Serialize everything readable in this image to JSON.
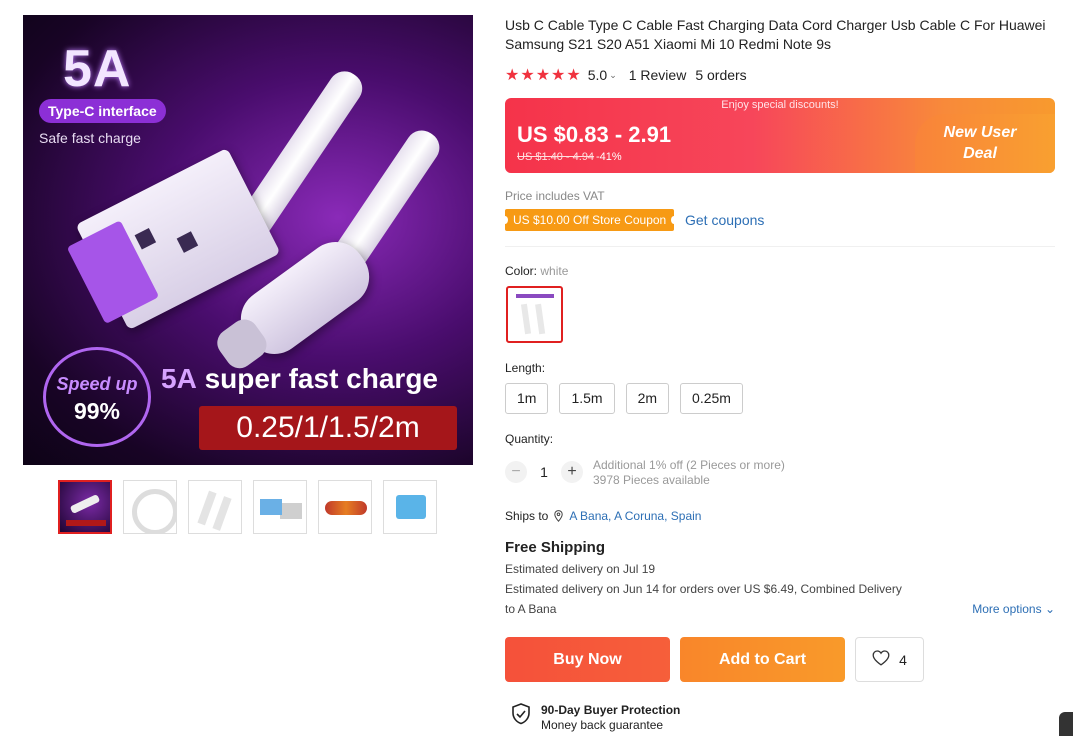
{
  "gallery": {
    "main_image": {
      "badge_5a": "5A",
      "badge_type_c": "Type-C interface",
      "safe_text": "Safe fast charge",
      "speed_label": "Speed up",
      "speed_value": "99%",
      "headline_prefix": "5A",
      "headline_rest": " super fast charge",
      "lengths_banner": "0.25/1/1.5/2m"
    },
    "thumbnail_count": 6
  },
  "product": {
    "title": "Usb C Cable Type C Cable Fast Charging Data Cord Charger Usb Cable C For Huawei Samsung S21 S20 A51 Xiaomi Mi 10 Redmi Note 9s",
    "stars": "★★★★★",
    "rating": "5.0",
    "reviews": "1 Review",
    "orders": "5 orders"
  },
  "deal": {
    "banner_text": "Enjoy special discounts!",
    "price": "US $0.83 - 2.91",
    "original_price": "US $1.40 - 4.94",
    "discount": "-41%",
    "new_user_line1": "New User",
    "new_user_line2": "Deal",
    "colors": {
      "start": "#f5334a",
      "end": "#f89a2e"
    }
  },
  "vat_text": "Price includes VAT",
  "coupon": {
    "label": "US $10.00 Off Store Coupon",
    "link": "Get coupons"
  },
  "color": {
    "label": "Color:",
    "value": "white"
  },
  "length": {
    "label": "Length:",
    "options": [
      "1m",
      "1.5m",
      "2m",
      "0.25m"
    ]
  },
  "quantity": {
    "label": "Quantity:",
    "minus": "−",
    "value": "1",
    "plus": "+",
    "discount_note": "Additional 1% off (2 Pieces or more)",
    "available": "3978 Pieces available"
  },
  "shipping": {
    "ships_to_label": "Ships to",
    "location": "A Bana, A Coruna, Spain",
    "free_shipping": "Free Shipping",
    "estimate1": "Estimated delivery on Jul 19",
    "estimate2": "Estimated delivery on Jun 14 for orders over US $6.49, Combined Delivery",
    "estimate3": "to A Bana",
    "more_options": "More options"
  },
  "actions": {
    "buy_now": "Buy Now",
    "add_to_cart": "Add to Cart",
    "wishlist_count": "4"
  },
  "protection": {
    "title": "90-Day Buyer Protection",
    "subtitle": "Money back guarantee"
  }
}
